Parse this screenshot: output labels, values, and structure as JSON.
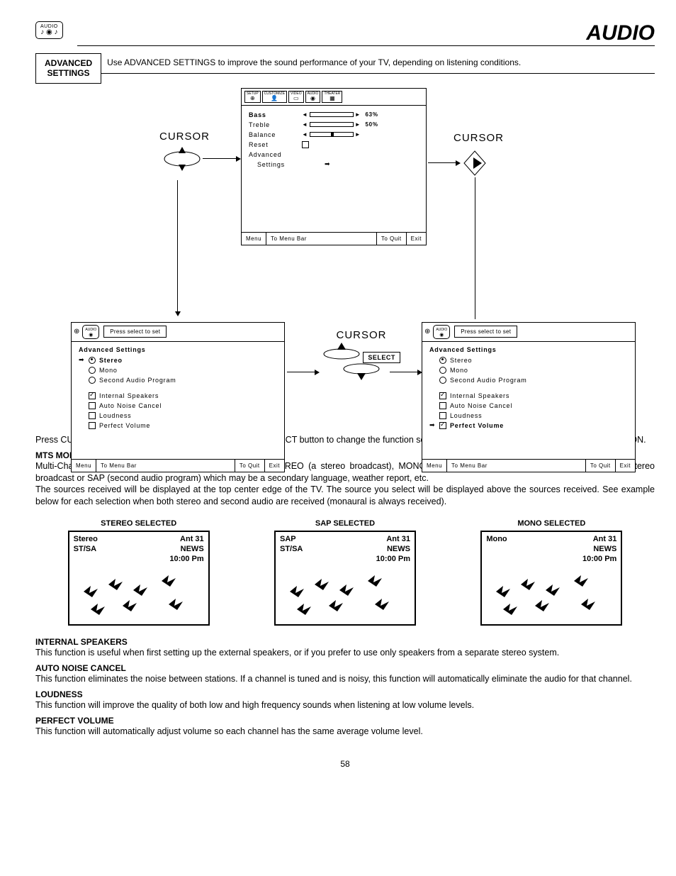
{
  "header": {
    "icon_label": "AUDIO",
    "page_title": "AUDIO"
  },
  "advanced_box": {
    "line1": "ADVANCED",
    "line2": "SETTINGS"
  },
  "intro": "Use ADVANCED SETTINGS to improve the sound performance of your TV, depending on listening conditions.",
  "top_screen": {
    "tabs": [
      "SETUP",
      "CUSTOMIZE",
      "VIDEO",
      "AUDIO",
      "THEATER"
    ],
    "rows": {
      "bass": {
        "label": "Bass",
        "value": "63%"
      },
      "treble": {
        "label": "Treble",
        "value": "50%"
      },
      "balance": {
        "label": "Balance"
      },
      "reset": {
        "label": "Reset"
      },
      "adv1": {
        "label": "Advanced"
      },
      "adv2": {
        "label": "Settings"
      }
    },
    "footer": {
      "menu": "Menu",
      "to_bar": "To Menu Bar",
      "to_quit": "To Quit",
      "exit": "Exit"
    }
  },
  "cursor_label": "CURSOR",
  "select_label": "SELECT",
  "adv_screen": {
    "press": "Press select to set",
    "title": "Advanced Settings",
    "stereo": "Stereo",
    "mono": "Mono",
    "sap": "Second Audio Program",
    "internal": "Internal Speakers",
    "anc": "Auto Noise Cancel",
    "loud": "Loudness",
    "pv": "Perfect Volume",
    "footer": {
      "menu": "Menu",
      "to_bar": "To Menu Bar",
      "to_quit": "To Quit",
      "exit": "Exit"
    }
  },
  "instruction": "Press CURSOR ▲ or ▼ to highlight a function. Press the SELECT button to change the function setting. When the function has an \" ✓ \" in the box, it is ON.",
  "mts": {
    "title": "MTS MODE",
    "p1": "Multi-Channel Television Sound will allow you to select STEREO (a stereo broadcast), MONO (monaural sound) used when receiving a weak stereo broadcast or SAP (second audio program) which may be a secondary language, weather report, etc.",
    "p2": "The sources received will be displayed at the top center edge of the TV.  The source you select will be displayed above the sources received.  See example below for each selection when both stereo and second audio are received (monaural is always received)."
  },
  "examples": {
    "stereo": {
      "title": "STEREO SELECTED",
      "mode": "Stereo",
      "src": "ST/SA",
      "ant": "Ant   31",
      "news": "NEWS",
      "time": "10:00 Pm"
    },
    "sap": {
      "title": "SAP SELECTED",
      "mode": "SAP",
      "src": "ST/SA",
      "ant": "Ant   31",
      "news": "NEWS",
      "time": "10:00 Pm"
    },
    "mono": {
      "title": "MONO SELECTED",
      "mode": "Mono",
      "src": "",
      "ant": "Ant   31",
      "news": "NEWS",
      "time": "10:00 Pm"
    }
  },
  "sections": {
    "is": {
      "title": "INTERNAL SPEAKERS",
      "body": "This function is useful when first setting up the external speakers, or if you prefer to use only speakers from a separate stereo system."
    },
    "anc": {
      "title": "AUTO NOISE CANCEL",
      "body": "This function eliminates the noise between stations. If a channel is tuned and is noisy, this function will automatically eliminate the audio for that channel."
    },
    "loud": {
      "title": "LOUDNESS",
      "body": "This function will improve the quality of both low and high frequency sounds when listening at low volume levels."
    },
    "pv": {
      "title": "PERFECT VOLUME",
      "body": "This function will automatically adjust volume so each channel has the same average volume level."
    }
  },
  "page_number": "58"
}
